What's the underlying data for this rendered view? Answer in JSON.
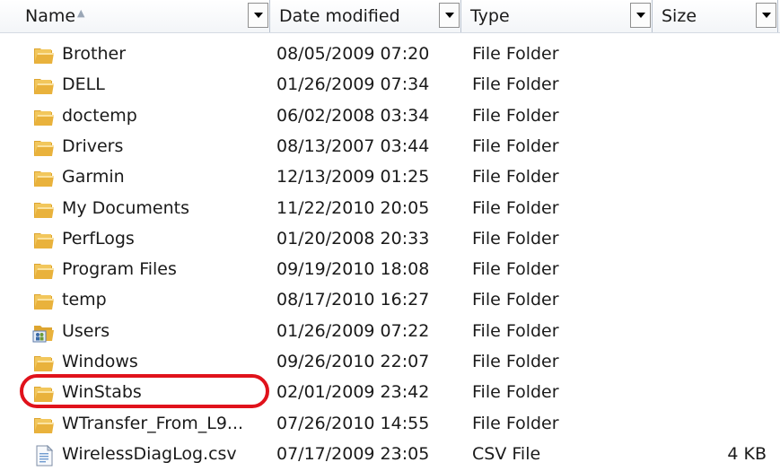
{
  "header": {
    "name": "Name",
    "date_modified": "Date modified",
    "type": "Type",
    "size": "Size"
  },
  "files": [
    {
      "name": "Brother",
      "date": "08/05/2009 07:20",
      "type": "File Folder",
      "size": "",
      "icon": "folder-icon"
    },
    {
      "name": "DELL",
      "date": "01/26/2009 07:34",
      "type": "File Folder",
      "size": "",
      "icon": "folder-icon"
    },
    {
      "name": "doctemp",
      "date": "06/02/2008 03:34",
      "type": "File Folder",
      "size": "",
      "icon": "folder-icon"
    },
    {
      "name": "Drivers",
      "date": "08/13/2007 03:44",
      "type": "File Folder",
      "size": "",
      "icon": "folder-icon"
    },
    {
      "name": "Garmin",
      "date": "12/13/2009 01:25",
      "type": "File Folder",
      "size": "",
      "icon": "folder-icon"
    },
    {
      "name": "My Documents",
      "date": "11/22/2010 20:05",
      "type": "File Folder",
      "size": "",
      "icon": "folder-icon"
    },
    {
      "name": "PerfLogs",
      "date": "01/20/2008 20:33",
      "type": "File Folder",
      "size": "",
      "icon": "folder-icon"
    },
    {
      "name": "Program Files",
      "date": "09/19/2010 18:08",
      "type": "File Folder",
      "size": "",
      "icon": "folder-icon"
    },
    {
      "name": "temp",
      "date": "08/17/2010 16:27",
      "type": "File Folder",
      "size": "",
      "icon": "folder-icon"
    },
    {
      "name": "Users",
      "date": "01/26/2009 07:22",
      "type": "File Folder",
      "size": "",
      "icon": "users-folder-icon"
    },
    {
      "name": "Windows",
      "date": "09/26/2010 22:07",
      "type": "File Folder",
      "size": "",
      "icon": "folder-icon"
    },
    {
      "name": "WinStabs",
      "date": "02/01/2009 23:42",
      "type": "File Folder",
      "size": "",
      "icon": "folder-icon"
    },
    {
      "name": "WTransfer_From_L9...",
      "date": "07/26/2010 14:55",
      "type": "File Folder",
      "size": "",
      "icon": "folder-icon"
    },
    {
      "name": "WirelessDiagLog.csv",
      "date": "07/17/2009 23:05",
      "type": "CSV File",
      "size": "4 KB",
      "icon": "csv-file-icon"
    }
  ],
  "annotation": {
    "highlighted_item": "WinStabs",
    "color": "#e0121b"
  }
}
